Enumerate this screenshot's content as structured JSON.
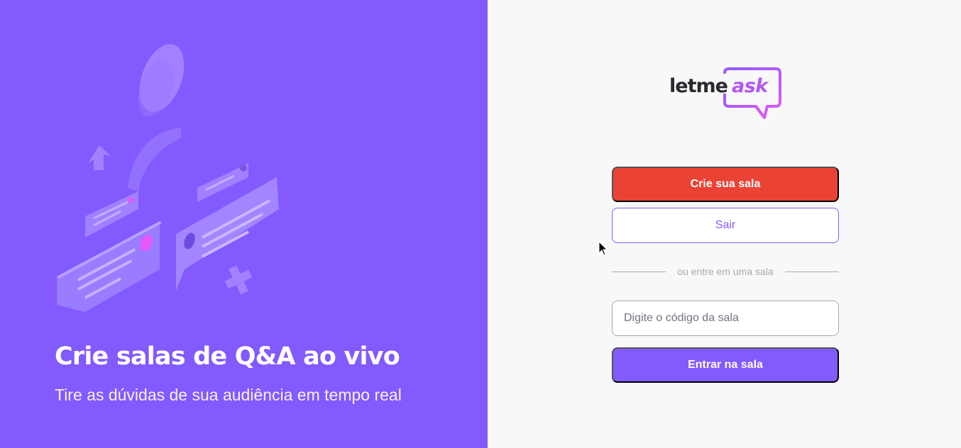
{
  "aside": {
    "title": "Crie salas de Q&A ao vivo",
    "subtitle": "Tire as dúvidas de sua audiência em tempo real",
    "illustration_icon": "qa-illustration"
  },
  "logo": {
    "part1": "letme",
    "part2": "ask"
  },
  "actions": {
    "create_room_label": "Crie sua sala",
    "logout_label": "Sair",
    "separator_text": "ou entre em uma sala",
    "room_code_placeholder": "Digite o código da sala",
    "enter_room_label": "Entrar na sala"
  },
  "colors": {
    "purple": "#835afd",
    "red": "#ea4335",
    "pink": "#e559f9",
    "background": "#f8f8f8"
  }
}
